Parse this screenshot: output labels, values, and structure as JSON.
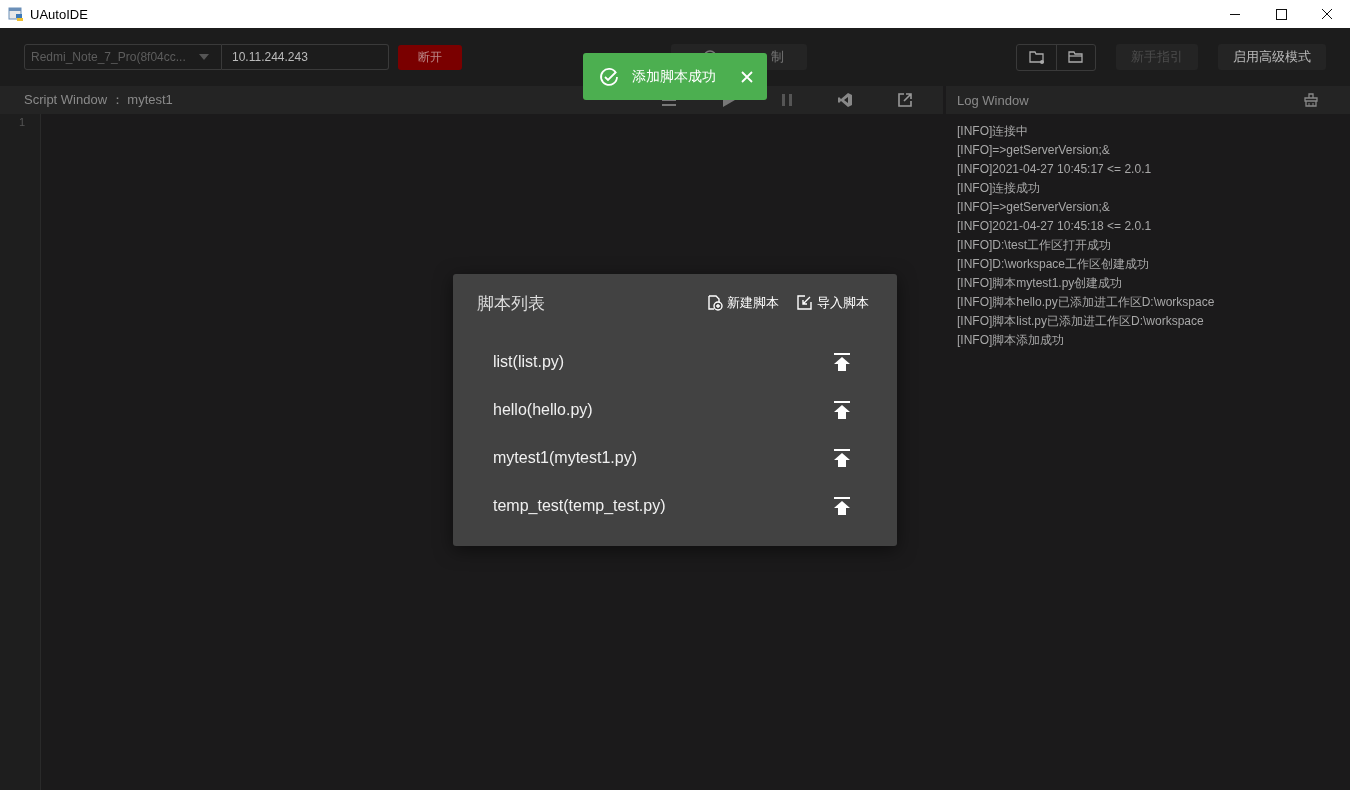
{
  "window": {
    "title": "UAutoIDE"
  },
  "toolbar": {
    "device": "Redmi_Note_7_Pro(8f04cc...",
    "ip": "10.11.244.243",
    "disconnect": "断开",
    "record": "制",
    "guide": {
      "label": "新手指引",
      "disabled": true
    },
    "advanced": "启用高级模式"
  },
  "toast": {
    "message": "添加脚本成功"
  },
  "script_window": {
    "title": "Script Window ： mytest1",
    "line_numbers": [
      "1"
    ]
  },
  "log_window": {
    "title": "Log Window",
    "lines": [
      "[INFO]连接中",
      "[INFO]=>getServerVersion;&",
      "[INFO]2021-04-27 10:45:17 <= 2.0.1",
      "[INFO]连接成功",
      "[INFO]=>getServerVersion;&",
      "[INFO]2021-04-27 10:45:18 <= 2.0.1",
      "[INFO]D:\\test工作区打开成功",
      "[INFO]D:\\workspace工作区创建成功",
      "[INFO]脚本mytest1.py创建成功",
      "[INFO]脚本hello.py已添加进工作区D:\\workspace",
      "[INFO]脚本list.py已添加进工作区D:\\workspace",
      "[INFO]脚本添加成功"
    ]
  },
  "dialog": {
    "title": "脚本列表",
    "actions": [
      {
        "kind": "new",
        "label": "新建脚本"
      },
      {
        "kind": "import",
        "label": "导入脚本"
      }
    ],
    "scripts": [
      "list(list.py)",
      "hello(hello.py)",
      "mytest1(mytest1.py)",
      "temp_test(temp_test.py)"
    ]
  }
}
